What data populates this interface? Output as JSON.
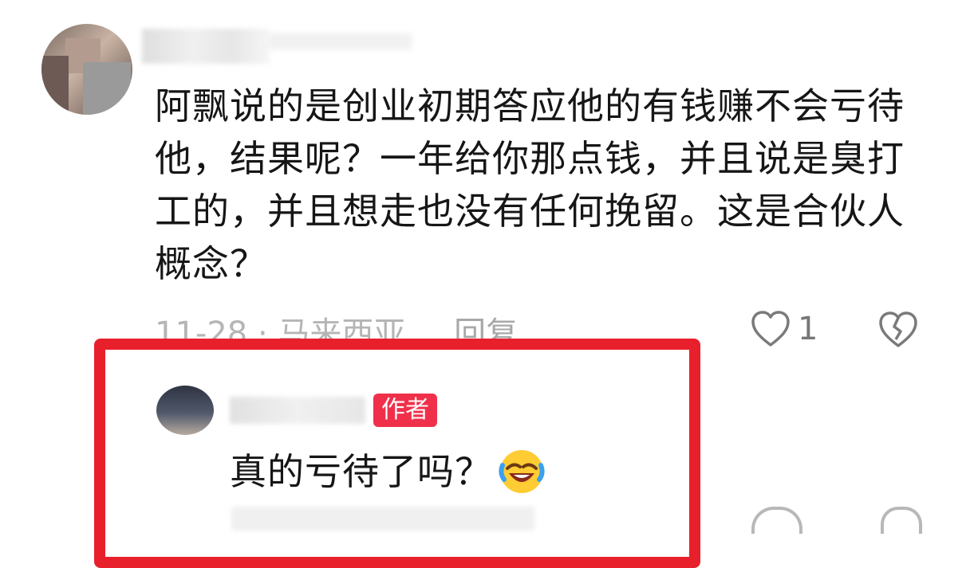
{
  "comment": {
    "text_lines": [
      "阿飘说的是创业初期答应他的有钱赚不会亏待",
      "他，结果呢？一年给你那点钱，并且说是臭打",
      "工的，并且想走也没有任何挽留。这是合伙人",
      "概念？"
    ],
    "date_location": "11-28 · 马来西亚",
    "reply_label": "回复",
    "like_count": "1",
    "icons": {
      "like": "heart-outline-icon",
      "dislike": "broken-heart-icon"
    }
  },
  "reply": {
    "author_badge": "作者",
    "text": "真的亏待了吗？",
    "emoji": "rolling-on-floor-laughing-emoji"
  },
  "colors": {
    "highlight": "#e8202b",
    "badge": "#f0304a",
    "meta_text": "#b5b5b5"
  }
}
